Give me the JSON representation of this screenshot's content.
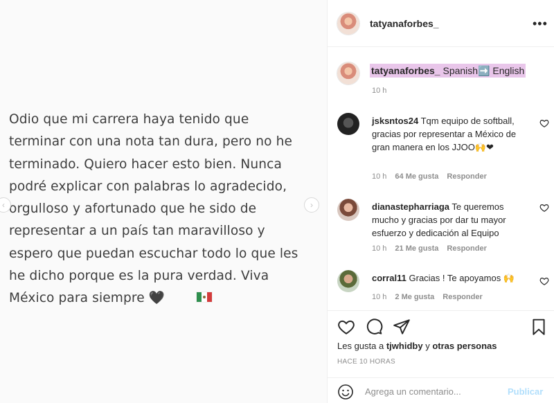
{
  "post": {
    "text": "Odio que mi carrera haya tenido que\nterminar con una nota tan dura, pero no he\nterminado. Quiero hacer esto bien. Nunca\npodré explicar con palabras lo agradecido,\norgulloso y afortunado que he sido de\nrepresentar a un país tan maravilloso y\nespero que puedan escuchar todo lo que les\nhe dicho porque es la pura verdad. Viva\nMéxico para siempre 🖤",
    "prev_icon": "chevron-left-icon",
    "next_icon": "chevron-right-icon"
  },
  "header": {
    "username": "tatyanaforbes_",
    "more_icon": "more-dots-icon"
  },
  "caption": {
    "username": "tatyanaforbes_",
    "text": "Spanish➡️ English",
    "time": "10 h"
  },
  "comments": [
    {
      "username": "jsksntos24",
      "text": "Tqm equipo de softball, gracias por representar a México de gran manera en los JJOO🙌❤",
      "time": "10 h",
      "likes": "64 Me gusta",
      "reply": "Responder"
    },
    {
      "username": "dianastepharriaga",
      "text": "Te queremos mucho y gracias por dar tu mayor esfuerzo y dedicación al Equipo",
      "time": "10 h",
      "likes": "21 Me gusta",
      "reply": "Responder"
    },
    {
      "username": "corral11",
      "text": "Gracias ! Te apoyamos 🙌",
      "time": "10 h",
      "likes": "2 Me gusta",
      "reply": "Responder"
    }
  ],
  "actions": {
    "likes_prefix": "Les gusta a",
    "likes_user": "tjwhidby",
    "likes_connector": "y",
    "likes_others": "otras personas",
    "post_time": "HACE 10 HORAS"
  },
  "add_comment": {
    "placeholder": "Agrega un comentario...",
    "publish_label": "Publicar"
  },
  "colors": {
    "highlight": "#e9c6ea",
    "publish": "#b2dffc",
    "meta": "#8e8e8e"
  }
}
